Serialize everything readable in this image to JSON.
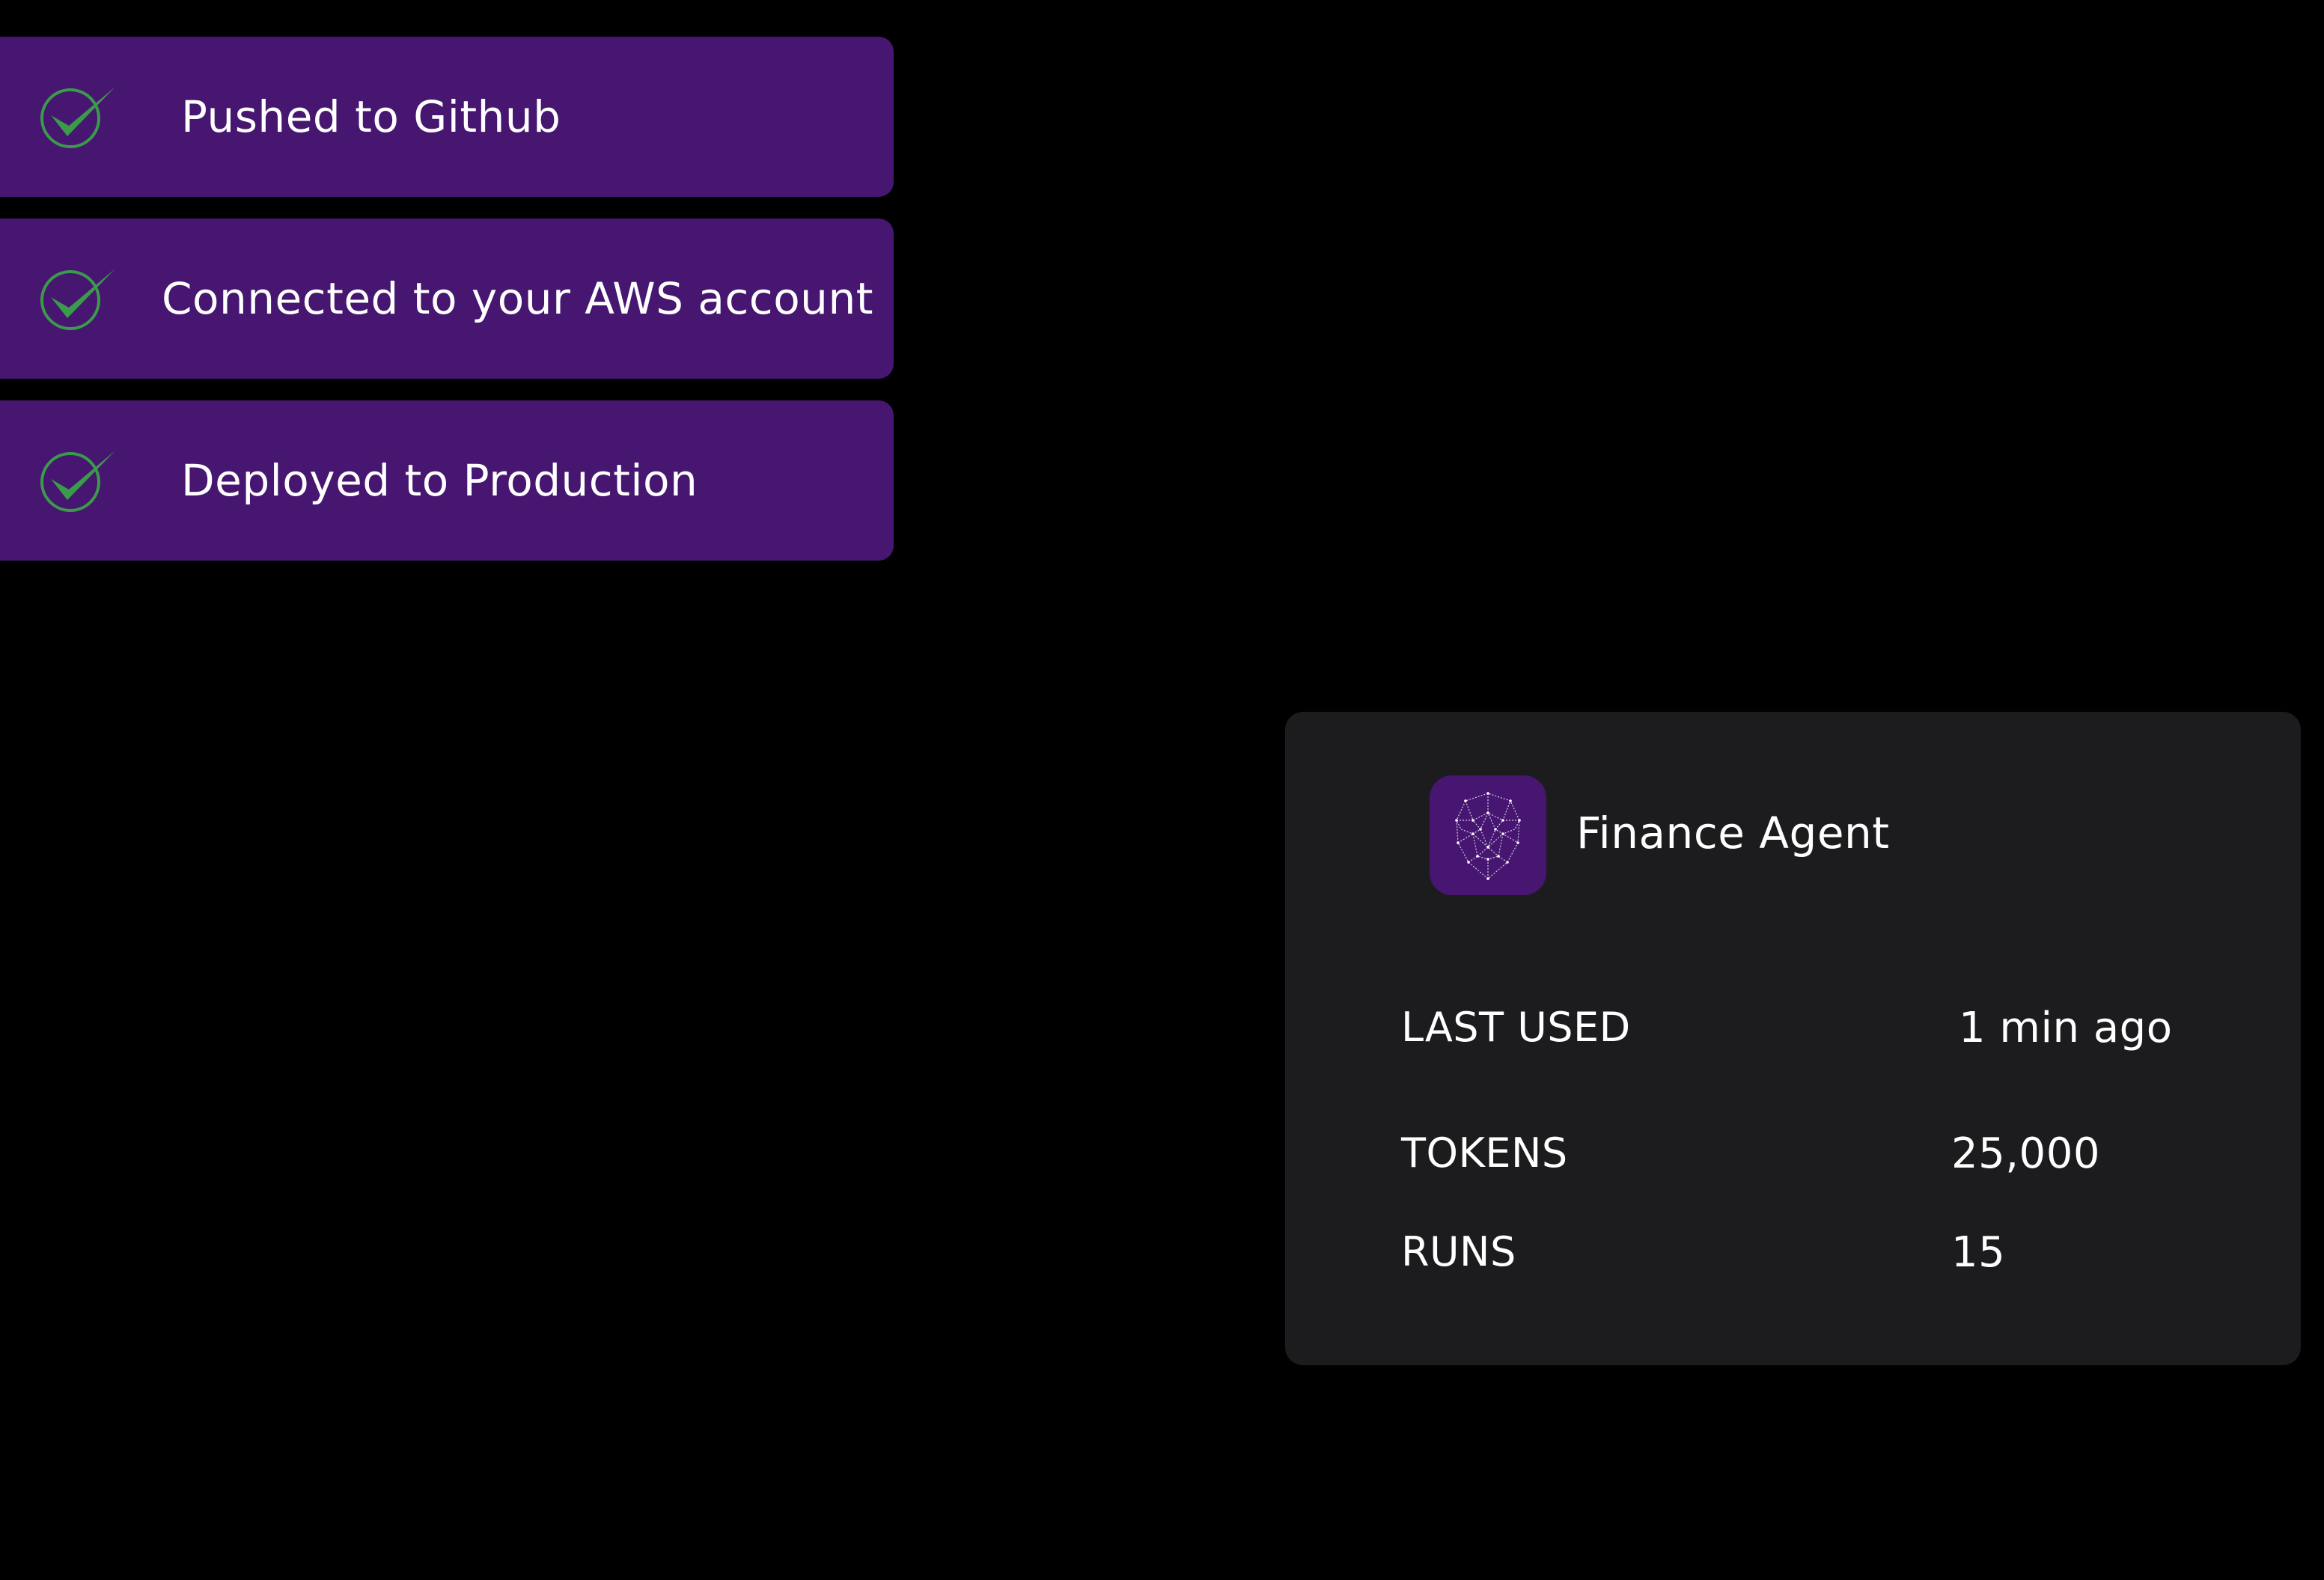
{
  "steps": [
    {
      "label": "Pushed to Github",
      "icon": "check-circle-icon",
      "status": "done"
    },
    {
      "label": "Connected to your AWS account",
      "icon": "check-circle-icon",
      "status": "done"
    },
    {
      "label": "Deployed to Production",
      "icon": "check-circle-icon",
      "status": "done"
    }
  ],
  "agent": {
    "name": "Finance Agent",
    "icon": "face-mesh-icon",
    "stats": {
      "last_used_label": "LAST USED",
      "last_used_value": "1 min ago",
      "tokens_label": "TOKENS",
      "tokens_value": "25,000",
      "runs_label": "RUNS",
      "runs_value": "15"
    }
  },
  "colors": {
    "background": "#000000",
    "step_bg": "#461670",
    "check": "#3a9b4a",
    "card_bg": "#1c1c1e",
    "avatar_bg": "#461670",
    "text": "#ffffff"
  }
}
